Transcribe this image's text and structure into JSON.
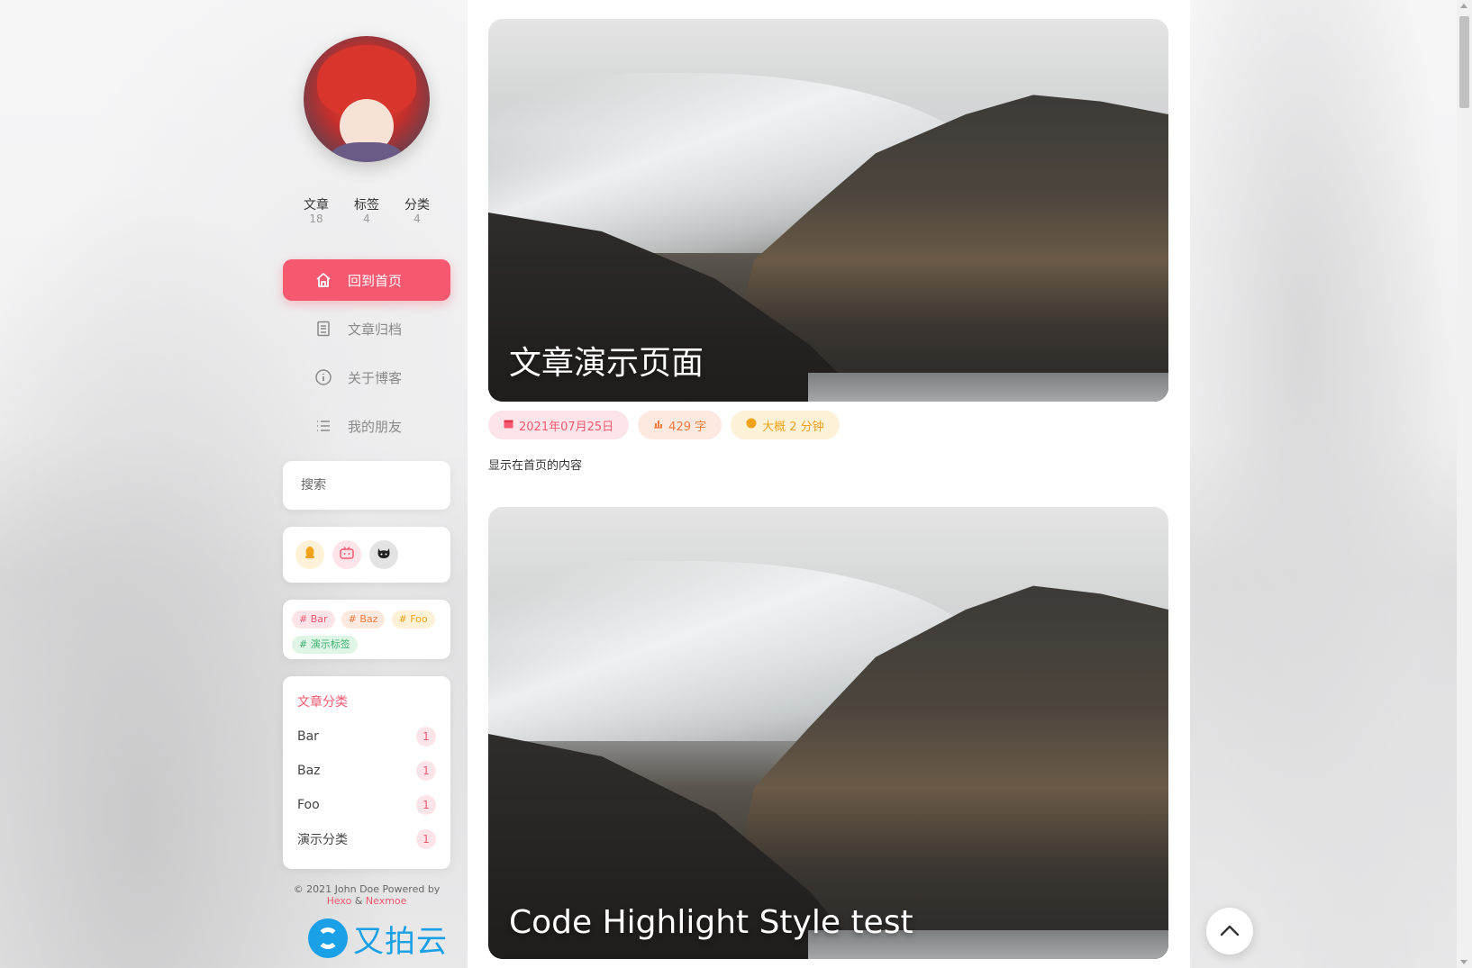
{
  "profile": {
    "stats": [
      {
        "label": "文章",
        "value": "18"
      },
      {
        "label": "标签",
        "value": "4"
      },
      {
        "label": "分类",
        "value": "4"
      }
    ]
  },
  "nav": [
    {
      "label": "回到首页",
      "icon": "home-icon",
      "active": true
    },
    {
      "label": "文章归档",
      "icon": "archive-icon",
      "active": false
    },
    {
      "label": "关于博客",
      "icon": "info-icon",
      "active": false
    },
    {
      "label": "我的朋友",
      "icon": "list-icon",
      "active": false
    }
  ],
  "search": {
    "placeholder": "搜索"
  },
  "social": [
    {
      "icon": "qq-icon",
      "color": "#f2a31a"
    },
    {
      "icon": "bilibili-icon",
      "color": "#f5586f"
    },
    {
      "icon": "github-icon",
      "color": "#333333"
    }
  ],
  "tags": [
    {
      "label": "# Bar",
      "color": "#f5586f"
    },
    {
      "label": "# Baz",
      "color": "#f07a3c"
    },
    {
      "label": "# Foo",
      "color": "#f2a31a"
    },
    {
      "label": "# 演示标签",
      "color": "#3cb371"
    }
  ],
  "categories": {
    "title": "文章分类",
    "items": [
      {
        "name": "Bar",
        "count": "1"
      },
      {
        "name": "Baz",
        "count": "1"
      },
      {
        "name": "Foo",
        "count": "1"
      },
      {
        "name": "演示分类",
        "count": "1"
      }
    ]
  },
  "footer": {
    "copyright": "© 2021 John Doe Powered by",
    "hexo": "Hexo",
    "amp": "&",
    "nexmoe": "Nexmoe"
  },
  "sponsor": {
    "logo_text": "又拍云"
  },
  "posts": [
    {
      "title": "文章演示页面",
      "date": "2021年07月25日",
      "words": "429 字",
      "read_time": "大概 2 分钟",
      "excerpt": "显示在首页的内容"
    },
    {
      "title": "Code Highlight Style test"
    }
  ],
  "colors": {
    "accent": "#f5586f",
    "orange": "#f07a3c",
    "yellow": "#f2a31a"
  }
}
